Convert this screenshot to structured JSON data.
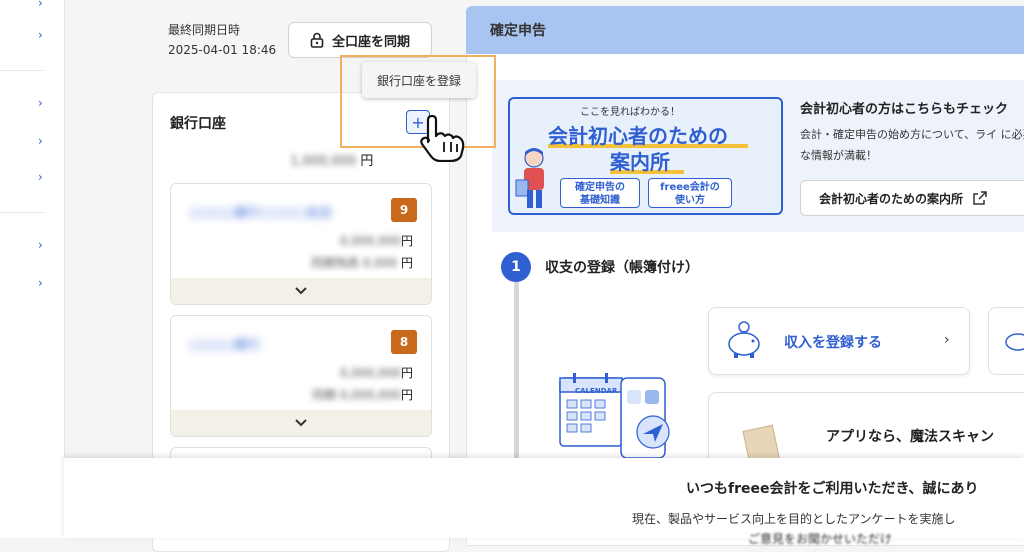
{
  "sync": {
    "label": "最終同期日時",
    "datetime": "2025-04-01 18:46",
    "button_label": "全口座を同期",
    "tooltip": "銀行口座を登録"
  },
  "bank": {
    "title": "銀行口座",
    "add_symbol": "+",
    "total_blurred": "1,000,000",
    "currency": "円",
    "accounts": [
      {
        "name_blurred": "○○○○銀行○○○○支店",
        "badge": "9",
        "value1_blurred": "0,000,000",
        "value2_blurred": "同期残高 0,000",
        "yen1": "円",
        "yen2": "円"
      },
      {
        "name_blurred": "○○○○銀行",
        "badge": "8",
        "value1_blurred": "0,000,000",
        "value2_blurred": "同期 0,000,000",
        "yen1": "円",
        "yen2": "円"
      }
    ]
  },
  "tax": {
    "title": "確定申告",
    "banner": {
      "sub": "ここを見ればわかる！",
      "title1": "会計初心者のための",
      "title2": "案内所",
      "pill1": "確定申告の\n基礎知識",
      "pill2": "freee会計の\n使い方"
    },
    "intro_title": "会計初心者の方はこちらもチェック",
    "intro_desc": "会計・確定申告の始め方について、ライ に必要な情報が満載！",
    "guide_button": "会計初心者のための案内所",
    "step_number": "1",
    "step_title": "収支の登録（帳簿付け）",
    "income_button": "収入を登録する",
    "app_text": "アプリなら、魔法スキャン",
    "calendar_label": "CALENDAR"
  },
  "survey": {
    "title": "いつもfreee会計をご利用いただき、誠にあり",
    "text": "現在、製品やサービス向上を目的としたアンケートを実施し",
    "text2": "ご意見をお聞かせいただけ"
  },
  "colors": {
    "accent": "#2f5fd0",
    "badge": "#c8691c",
    "header": "#a8c4f0",
    "highlight": "#f0b060"
  }
}
